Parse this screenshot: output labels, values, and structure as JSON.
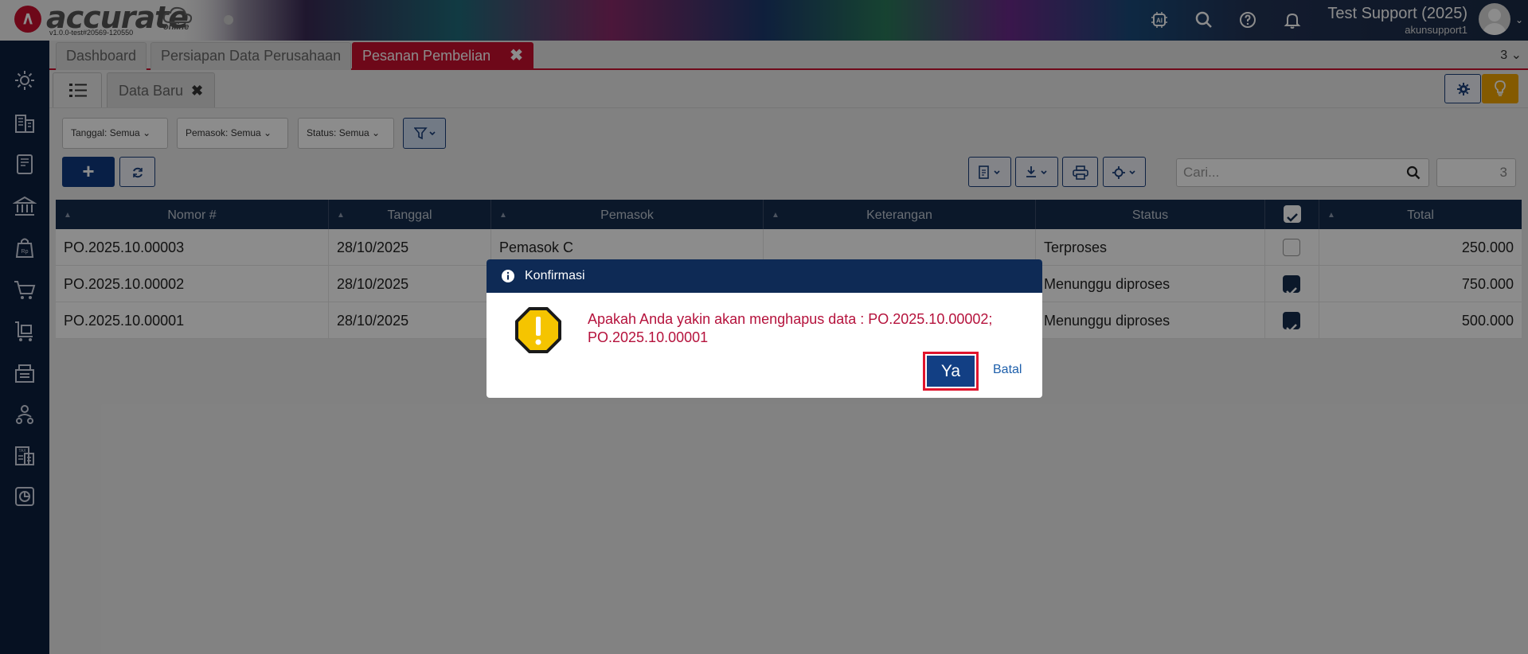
{
  "brand": {
    "logo_text": "accurate",
    "online": "online",
    "version": "v1.0.0-test#20569-120550"
  },
  "header": {
    "user_name": "Test Support (2025)",
    "user_sub": "akunsupport1"
  },
  "tabs": [
    {
      "label": "Dashboard"
    },
    {
      "label": "Persiapan Data Perusahaan"
    },
    {
      "label": "Pesanan Pembelian",
      "close": "✖"
    }
  ],
  "tab_count": "3",
  "subtab": {
    "label": "Data Baru",
    "close": "✖"
  },
  "filters": {
    "tanggal": "Tanggal: Semua",
    "pemasok": "Pemasok: Semua",
    "status": "Status: Semua"
  },
  "search": {
    "placeholder": "Cari...",
    "count": "3"
  },
  "table": {
    "columns": [
      "Nomor #",
      "Tanggal",
      "Pemasok",
      "Keterangan",
      "Status",
      "Total"
    ],
    "rows": [
      {
        "nomor": "PO.2025.10.00003",
        "tanggal": "28/10/2025",
        "pemasok": "Pemasok C",
        "keterangan": "",
        "status": "Terproses",
        "checked": false,
        "total": "250.000"
      },
      {
        "nomor": "PO.2025.10.00002",
        "tanggal": "28/10/2025",
        "pemasok": "",
        "keterangan": "",
        "status": "Menunggu diproses",
        "checked": true,
        "total": "750.000"
      },
      {
        "nomor": "PO.2025.10.00001",
        "tanggal": "28/10/2025",
        "pemasok": "",
        "keterangan": "",
        "status": "Menunggu diproses",
        "checked": true,
        "total": "500.000"
      }
    ]
  },
  "dialog": {
    "title": "Konfirmasi",
    "message": "Apakah Anda yakin akan menghapus data : PO.2025.10.00002; PO.2025.10.00001",
    "confirm": "Ya",
    "cancel": "Batal"
  },
  "colors": {
    "brand_red": "#c8102e",
    "navy": "#0e2a55",
    "sidebar": "#0c1f3f",
    "warning": "#f5c400"
  }
}
